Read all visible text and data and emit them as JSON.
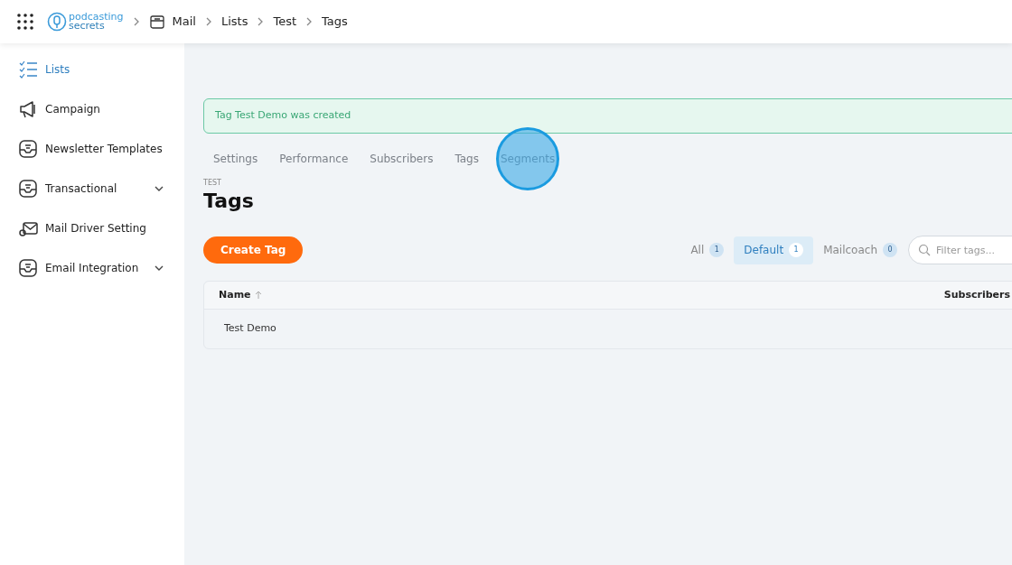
{
  "header": {
    "logo": {
      "line_1": "podcasting",
      "line_2": "secrets"
    },
    "breadcrumbs": [
      "Mail",
      "Lists",
      "Test",
      "Tags"
    ]
  },
  "sidebar": {
    "items": [
      {
        "label": "Lists",
        "selected": true
      },
      {
        "label": "Campaign",
        "selected": false
      },
      {
        "label": "Newsletter Templates",
        "selected": false
      },
      {
        "label": "Transactional",
        "selected": false,
        "expanded": false
      },
      {
        "label": "Mail Driver Setting",
        "selected": false
      },
      {
        "label": "Email Integration",
        "selected": false,
        "expanded": false
      }
    ]
  },
  "alert": {
    "text": "Tag Test Demo was created"
  },
  "tabs": [
    {
      "label": "Settings",
      "clicked": false
    },
    {
      "label": "Performance",
      "clicked": false
    },
    {
      "label": "Subscribers",
      "clicked": false
    },
    {
      "label": "Tags",
      "clicked": false
    },
    {
      "label": "Segments",
      "clicked": true
    }
  ],
  "page": {
    "overline": "TEST",
    "title": "Tags"
  },
  "create_button": "Create Tag",
  "filters": [
    {
      "label": "All",
      "count": "1",
      "selected": false
    },
    {
      "label": "Default",
      "count": "1",
      "selected": true
    },
    {
      "label": "Mailcoach",
      "count": "0",
      "selected": false
    }
  ],
  "search": {
    "placeholder": "Filter tags..."
  },
  "table": {
    "columns": [
      {
        "label": "Name",
        "sorted": true
      },
      {
        "label": "Subscribers",
        "sorted": false
      }
    ],
    "rows": [
      {
        "cells": [
          "Test Demo"
        ]
      }
    ]
  }
}
